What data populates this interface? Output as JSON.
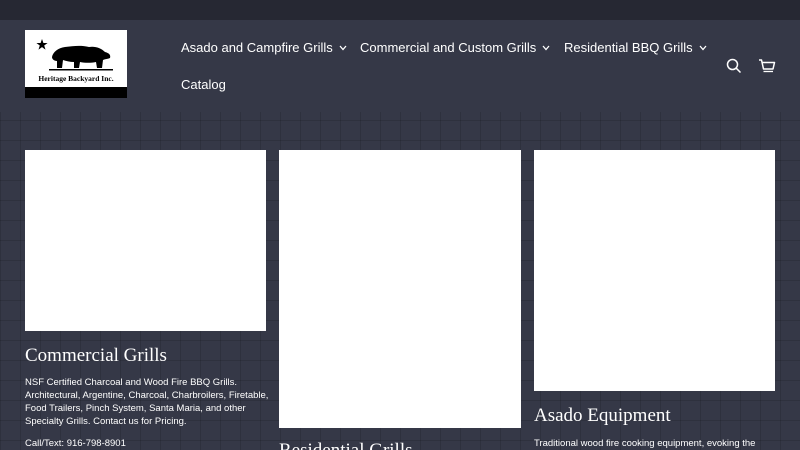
{
  "brand": {
    "logo_text": "Heritage Backyard Inc."
  },
  "nav": {
    "items": [
      {
        "label": "Asado and Campfire Grills",
        "has_dropdown": true
      },
      {
        "label": "Commercial and Custom Grills",
        "has_dropdown": true
      },
      {
        "label": "Residential BBQ Grills",
        "has_dropdown": true
      },
      {
        "label": "Catalog",
        "has_dropdown": false
      }
    ]
  },
  "header_icons": [
    "search-icon",
    "cart-icon"
  ],
  "cards": [
    {
      "title": "Commercial Grills",
      "description": "NSF Certified Charcoal and Wood Fire BBQ Grills. Architectural, Argentine, Charcoal, Charbroilers, Firetable, Food Trailers, Pinch System, Santa Maria, and other Specialty Grills. Contact us for Pricing.",
      "phone": "Call/Text: 916-798-8901"
    },
    {
      "title": "Residential Grills"
    },
    {
      "title": "Asado Equipment",
      "description": "Traditional wood fire cooking equipment, evoking the"
    }
  ],
  "colors": {
    "background": "#353847",
    "announcement_bar": "#262833",
    "text": "#ffffff",
    "card_image": "#ffffff"
  }
}
